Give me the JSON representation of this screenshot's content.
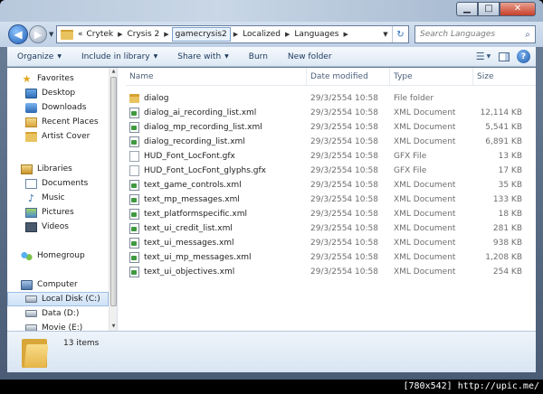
{
  "address": {
    "overflow": "«",
    "crumbs": [
      "Crytek",
      "Crysis 2",
      "gamecrysis2",
      "Localized",
      "Languages"
    ],
    "active_crumb": "gamecrysis2"
  },
  "search": {
    "placeholder": "Search Languages"
  },
  "toolbar": {
    "organize": "Organize",
    "include_in_library": "Include in library",
    "share_with": "Share with",
    "burn": "Burn",
    "new_folder": "New folder"
  },
  "navpane": {
    "favorites": {
      "label": "Favorites",
      "items": [
        "Desktop",
        "Downloads",
        "Recent Places",
        "Artist Cover"
      ]
    },
    "libraries": {
      "label": "Libraries",
      "items": [
        "Documents",
        "Music",
        "Pictures",
        "Videos"
      ]
    },
    "homegroup": {
      "label": "Homegroup"
    },
    "computer": {
      "label": "Computer",
      "items": [
        "Local Disk (C:)",
        "Data (D:)",
        "Movie (E:)"
      ]
    }
  },
  "columns": {
    "name": "Name",
    "date": "Date modified",
    "type": "Type",
    "size": "Size"
  },
  "files": [
    {
      "name": "dialog",
      "date": "29/3/2554 10:58",
      "type": "File folder",
      "size": "",
      "kind": "folder"
    },
    {
      "name": "dialog_ai_recording_list.xml",
      "date": "29/3/2554 10:58",
      "type": "XML Document",
      "size": "12,114 KB",
      "kind": "xml"
    },
    {
      "name": "dialog_mp_recording_list.xml",
      "date": "29/3/2554 10:58",
      "type": "XML Document",
      "size": "5,541 KB",
      "kind": "xml"
    },
    {
      "name": "dialog_recording_list.xml",
      "date": "29/3/2554 10:58",
      "type": "XML Document",
      "size": "6,891 KB",
      "kind": "xml"
    },
    {
      "name": "HUD_Font_LocFont.gfx",
      "date": "29/3/2554 10:58",
      "type": "GFX File",
      "size": "13 KB",
      "kind": "gfx"
    },
    {
      "name": "HUD_Font_LocFont_glyphs.gfx",
      "date": "29/3/2554 10:58",
      "type": "GFX File",
      "size": "17 KB",
      "kind": "gfx"
    },
    {
      "name": "text_game_controls.xml",
      "date": "29/3/2554 10:58",
      "type": "XML Document",
      "size": "35 KB",
      "kind": "xml"
    },
    {
      "name": "text_mp_messages.xml",
      "date": "29/3/2554 10:58",
      "type": "XML Document",
      "size": "133 KB",
      "kind": "xml"
    },
    {
      "name": "text_platformspecific.xml",
      "date": "29/3/2554 10:58",
      "type": "XML Document",
      "size": "18 KB",
      "kind": "xml"
    },
    {
      "name": "text_ui_credit_list.xml",
      "date": "29/3/2554 10:58",
      "type": "XML Document",
      "size": "281 KB",
      "kind": "xml"
    },
    {
      "name": "text_ui_messages.xml",
      "date": "29/3/2554 10:58",
      "type": "XML Document",
      "size": "938 KB",
      "kind": "xml"
    },
    {
      "name": "text_ui_mp_messages.xml",
      "date": "29/3/2554 10:58",
      "type": "XML Document",
      "size": "1,208 KB",
      "kind": "xml"
    },
    {
      "name": "text_ui_objectives.xml",
      "date": "29/3/2554 10:58",
      "type": "XML Document",
      "size": "254 KB",
      "kind": "xml"
    }
  ],
  "details": {
    "count": "13 items"
  },
  "watermark": "[780x542] http://upic.me/"
}
